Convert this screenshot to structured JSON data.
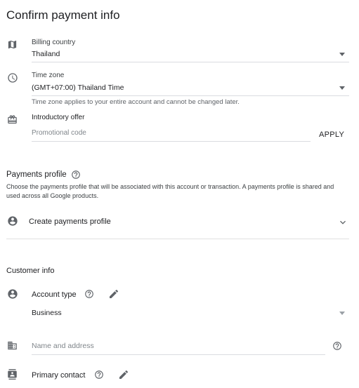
{
  "page": {
    "title": "Confirm payment info"
  },
  "billing": {
    "label": "Billing country",
    "value": "Thailand"
  },
  "timezone": {
    "label": "Time zone",
    "value": "(GMT+07:00) Thailand Time",
    "hint": "Time zone applies to your entire account and cannot be changed later."
  },
  "offer": {
    "label": "Introductory offer",
    "placeholder": "Promotional code",
    "apply_label": "APPLY"
  },
  "payments_profile": {
    "title": "Payments profile",
    "description": "Choose the payments profile that will be associated with this account or transaction. A payments profile is shared and used across all Google products.",
    "create_label": "Create payments profile"
  },
  "customer_info": {
    "title": "Customer info",
    "account_type": {
      "label": "Account type",
      "value": "Business"
    },
    "name_address": {
      "placeholder": "Name and address"
    },
    "primary_contact": {
      "label": "Primary contact"
    }
  },
  "icons": {
    "map": "map-icon",
    "clock": "clock-icon",
    "gift": "gift-icon",
    "help": "help-icon",
    "person": "person-icon",
    "pencil": "pencil-icon",
    "building": "building-icon",
    "contact": "contact-card-icon",
    "chevron": "chevron-down-icon"
  }
}
